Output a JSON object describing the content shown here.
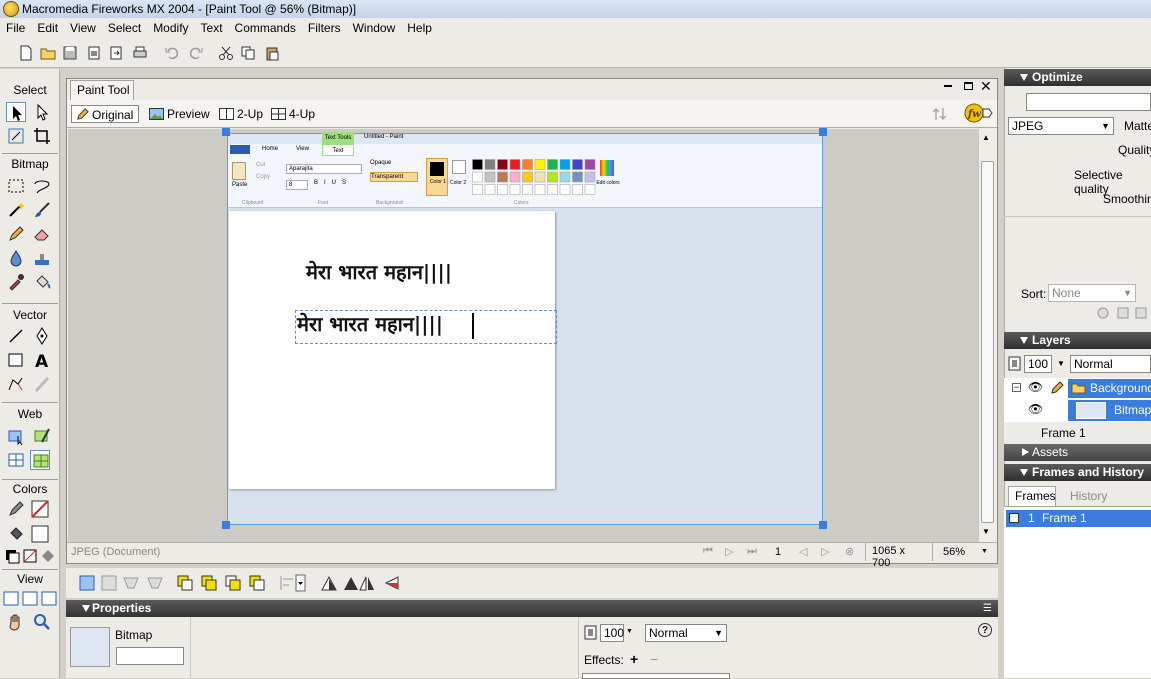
{
  "window": {
    "title": "Macromedia Fireworks MX 2004 - [Paint Tool @ 56% (Bitmap)]"
  },
  "menu": [
    "File",
    "Edit",
    "View",
    "Select",
    "Modify",
    "Text",
    "Commands",
    "Filters",
    "Window",
    "Help"
  ],
  "tools": {
    "sections": [
      "Select",
      "Bitmap",
      "Vector",
      "Web",
      "Colors",
      "View"
    ]
  },
  "document": {
    "tab": "Paint Tool",
    "views": [
      "Original",
      "Preview",
      "2-Up",
      "4-Up"
    ],
    "status": {
      "format": "JPEG (Document)",
      "frame": "1",
      "size": "1065 x 700",
      "zoom": "56%"
    }
  },
  "paint_image": {
    "tabs": [
      "Home",
      "View",
      "Text"
    ],
    "contextual_tab": "Text Tools",
    "title": "Untitled - Paint",
    "group_labels": [
      "Clipboard",
      "Font",
      "Background",
      "Colors"
    ],
    "buttons": [
      "Paste",
      "Cut",
      "Copy",
      "Opaque",
      "Transparent",
      "Color 1",
      "Color 2",
      "Edit colors"
    ],
    "font_name": "Aparajita",
    "font_size": "8",
    "line1": "मेरा भारत महान||||",
    "line2": "मेरा भारत महान||||",
    "palette": [
      "#000000",
      "#7f7f7f",
      "#880015",
      "#ed1c24",
      "#ff7f27",
      "#fff200",
      "#22b14c",
      "#00a2e8",
      "#3f48cc",
      "#a349a4",
      "#ffffff",
      "#c3c3c3",
      "#b97a57",
      "#ffaec9",
      "#ffc90e",
      "#efe4b0",
      "#b5e61d",
      "#99d9ea",
      "#7092be",
      "#c8bfe7"
    ]
  },
  "properties": {
    "title": "Properties",
    "object_type": "Bitmap",
    "opacity": "100",
    "blend": "Normal",
    "effects_label": "Effects:"
  },
  "optimize": {
    "title": "Optimize",
    "format": "JPEG",
    "matte_label": "Matte",
    "quality_label": "Quality",
    "selective_label": "Selective quality",
    "smoothing_label": "Smoothing",
    "sort_label": "Sort:",
    "sort_value": "None"
  },
  "layers": {
    "title": "Layers",
    "opacity": "100",
    "blend": "Normal",
    "layer_name": "Background",
    "object_name": "Bitmap",
    "frame": "Frame 1"
  },
  "assets": {
    "title": "Assets"
  },
  "frames": {
    "title": "Frames and History",
    "tabs": [
      "Frames",
      "History"
    ],
    "row_number": "1",
    "row_label": "Frame 1"
  },
  "colors": {
    "accent": "#3a7ddc",
    "panel_header": "#3a3a3a",
    "canvas_border": "#5a9fe0"
  }
}
